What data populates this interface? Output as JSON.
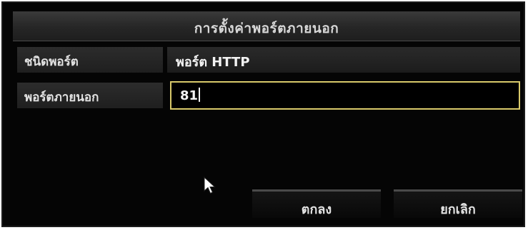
{
  "dialog": {
    "title": "การตั้งค่าพอร์ตภายนอก"
  },
  "fields": [
    {
      "label": "ชนิดพอร์ต",
      "value": "พอร์ต HTTP"
    },
    {
      "label": "พอร์ตภายนอก",
      "value": "81"
    }
  ],
  "buttons": {
    "ok_label": "ตกลง",
    "cancel_label": "ยกเลิก"
  },
  "colors": {
    "background": "#050505",
    "input_focus_border": "#d8c96a",
    "text": "#e2e2e2"
  },
  "icons": {
    "pointer": "mouse-pointer-icon"
  }
}
